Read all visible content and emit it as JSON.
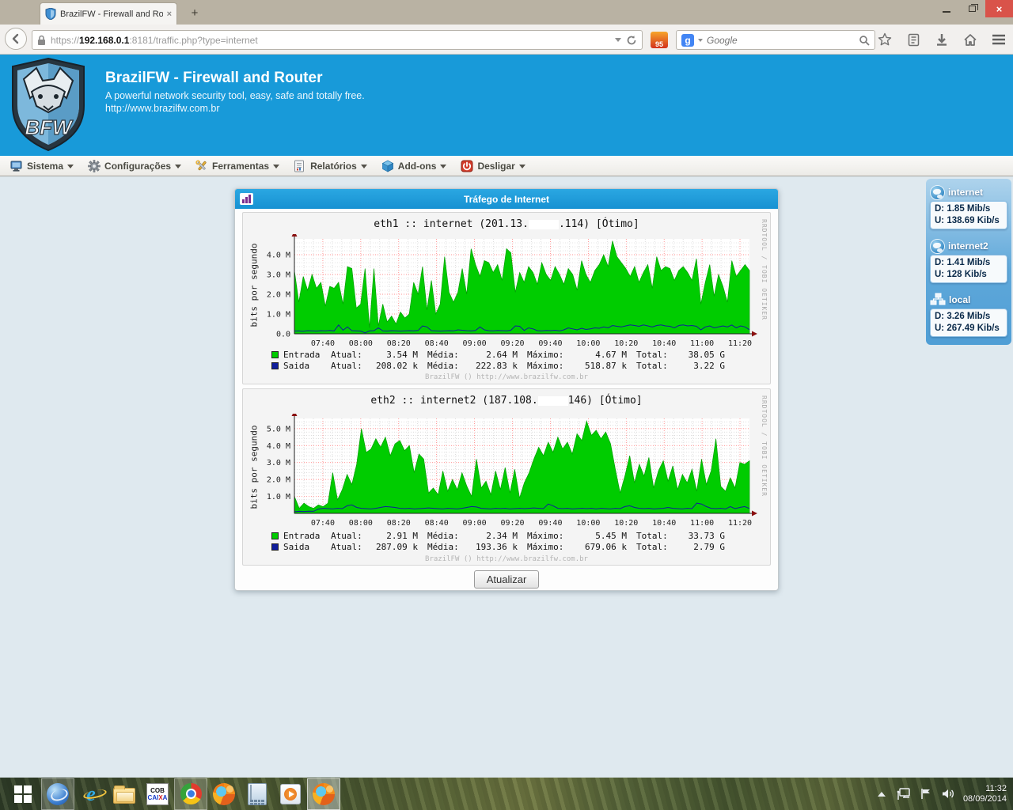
{
  "browser": {
    "tab": {
      "title": "BrazilFW - Firewall and Rou...",
      "close_glyph": "×"
    },
    "new_tab_glyph": "+",
    "url": {
      "protocol": "https://",
      "domain": "192.168.0.1",
      "rest": ":8181/traffic.php?type=internet"
    },
    "extension_badge": "95",
    "search": {
      "engine_initial": "g",
      "placeholder": "Google"
    }
  },
  "site_header": {
    "title": "BrazilFW - Firewall and Router",
    "subtitle": "A powerful network security tool, easy, safe and totally free.",
    "url": "http://www.brazilfw.com.br",
    "logo_text": "BFW"
  },
  "menu": {
    "caret": "▼",
    "items": [
      {
        "label": "Sistema",
        "icon": "computer-icon"
      },
      {
        "label": "Configurações",
        "icon": "gear-icon"
      },
      {
        "label": "Ferramentas",
        "icon": "tools-icon"
      },
      {
        "label": "Relatórios",
        "icon": "report-icon"
      },
      {
        "label": "Add-ons",
        "icon": "addon-cube-icon"
      },
      {
        "label": "Desligar",
        "icon": "power-icon"
      }
    ]
  },
  "panel": {
    "title": "Tráfego de Internet",
    "refresh_button": "Atualizar",
    "legend_labels": {
      "atual": "Atual:",
      "media": "Média:",
      "maximo": "Máximo:",
      "total": "Total:"
    },
    "graphs": [
      {
        "title_prefix": "eth1 :: internet (201.13.",
        "title_suffix": ".114) [Ótimo]",
        "ylabel": "bits por segundo",
        "credit": "RRDTOOL / TOBI OETIKER",
        "watermark": "BrazilFW () http://www.brazilfw.com.br",
        "legend_rows": [
          {
            "name": "Entrada",
            "color": "#00CC00",
            "atual": "3.54 M",
            "media": "2.64 M",
            "maximo": "4.67 M",
            "total": "38.05 G"
          },
          {
            "name": "Saida",
            "color": "#101E9C",
            "atual": "208.02 k",
            "media": "222.83 k",
            "maximo": "518.87 k",
            "total": "3.22 G"
          }
        ]
      },
      {
        "title_prefix": "eth2 :: internet2 (187.108.",
        "title_suffix": "146) [Ótimo]",
        "ylabel": "bits por segundo",
        "credit": "RRDTOOL / TOBI OETIKER",
        "watermark": "BrazilFW () http://www.brazilfw.com.br",
        "legend_rows": [
          {
            "name": "Entrada",
            "color": "#00CC00",
            "atual": "2.91 M",
            "media": "2.34 M",
            "maximo": "5.45 M",
            "total": "33.73 G"
          },
          {
            "name": "Saida",
            "color": "#101E9C",
            "atual": "287.09 k",
            "media": "193.36 k",
            "maximo": "679.06 k",
            "total": "2.79 G"
          }
        ]
      }
    ]
  },
  "chart_data": [
    {
      "type": "area",
      "title": "eth1 :: internet (201.13.***.114) [Ótimo]",
      "xlabel": "",
      "ylabel": "bits por segundo",
      "x_ticks": [
        "07:40",
        "08:00",
        "08:20",
        "08:40",
        "09:00",
        "09:20",
        "09:40",
        "10:00",
        "10:20",
        "10:40",
        "11:00",
        "11:20"
      ],
      "y_ticks": [
        {
          "v": 0,
          "label": "0.0"
        },
        {
          "v": 1,
          "label": "1.0 M"
        },
        {
          "v": 2,
          "label": "2.0 M"
        },
        {
          "v": 3,
          "label": "3.0 M"
        },
        {
          "v": 4,
          "label": "4.0 M"
        }
      ],
      "ylim_m": 4.8,
      "grid": true,
      "legend_position": "bottom",
      "series": [
        {
          "name": "Entrada",
          "style": "area",
          "color": "#00CC00",
          "values_mbps": [
            3.2,
            1.6,
            2.9,
            2.2,
            3.0,
            2.3,
            2.6,
            1.4,
            2.4,
            2.3,
            2.6,
            1.5,
            3.4,
            3.3,
            1.3,
            1.5,
            3.3,
            0.3,
            3.3,
            0.4,
            1.5,
            0.6,
            0.9,
            0.5,
            1.1,
            0.8,
            1.0,
            2.6,
            2.0,
            3.4,
            1.2,
            2.7,
            1.0,
            1.5,
            3.9,
            2.1,
            1.6,
            2.1,
            3.3,
            2.0,
            4.3,
            3.5,
            2.9,
            3.7,
            3.6,
            3.1,
            3.5,
            2.7,
            4.3,
            4.1,
            2.1,
            3.1,
            2.6,
            3.4,
            3.1,
            2.5,
            3.6,
            3.0,
            2.7,
            3.4,
            3.0,
            2.5,
            3.3,
            3.0,
            2.2,
            3.7,
            3.0,
            2.6,
            3.2,
            3.5,
            4.0,
            3.4,
            4.7,
            3.9,
            3.6,
            3.3,
            2.9,
            3.4,
            2.6,
            3.1,
            3.5,
            2.3,
            3.9,
            3.2,
            3.4,
            3.3,
            2.7,
            3.2,
            3.4,
            3.1,
            2.7,
            3.8,
            1.5,
            2.6,
            3.5,
            1.9,
            3.0,
            2.4,
            1.6,
            3.7,
            2.9,
            3.2,
            3.5,
            3.2
          ]
        },
        {
          "name": "Saida",
          "style": "line",
          "color": "#101E9C",
          "values_mbps": [
            0.14,
            0.15,
            0.13,
            0.16,
            0.15,
            0.14,
            0.16,
            0.15,
            0.17,
            0.15,
            0.45,
            0.18,
            0.35,
            0.16,
            0.15,
            0.14,
            0.05,
            0.15,
            0.16,
            0.3,
            0.15,
            0.14,
            0.16,
            0.15,
            0.14,
            0.15,
            0.16,
            0.15,
            0.17,
            0.4,
            0.35,
            0.16,
            0.15,
            0.14,
            0.15,
            0.16,
            0.15,
            0.2,
            0.18,
            0.16,
            0.15,
            0.17,
            0.35,
            0.2,
            0.16,
            0.15,
            0.17,
            0.16,
            0.15,
            0.18,
            0.4,
            0.38,
            0.17,
            0.3,
            0.25,
            0.16,
            0.15,
            0.17,
            0.16,
            0.18,
            0.15,
            0.2,
            0.3,
            0.25,
            0.2,
            0.28,
            0.22,
            0.25,
            0.3,
            0.28,
            0.35,
            0.3,
            0.42,
            0.38,
            0.35,
            0.4,
            0.45,
            0.42,
            0.38,
            0.45,
            0.4,
            0.35,
            0.42,
            0.45,
            0.4,
            0.38,
            0.3,
            0.42,
            0.45,
            0.4,
            0.42,
            0.38,
            0.2,
            0.35,
            0.4,
            0.3,
            0.35,
            0.4,
            0.35,
            0.45,
            0.3,
            0.4,
            0.35,
            0.21
          ]
        }
      ]
    },
    {
      "type": "area",
      "title": "eth2 :: internet2 (187.108.*** 146) [Ótimo]",
      "xlabel": "",
      "ylabel": "bits por segundo",
      "x_ticks": [
        "07:40",
        "08:00",
        "08:20",
        "08:40",
        "09:00",
        "09:20",
        "09:40",
        "10:00",
        "10:20",
        "10:40",
        "11:00",
        "11:20"
      ],
      "y_ticks": [
        {
          "v": 1,
          "label": "1.0 M"
        },
        {
          "v": 2,
          "label": "2.0 M"
        },
        {
          "v": 3,
          "label": "3.0 M"
        },
        {
          "v": 4,
          "label": "4.0 M"
        },
        {
          "v": 5,
          "label": "5.0 M"
        }
      ],
      "ylim_m": 5.6,
      "grid": true,
      "legend_position": "bottom",
      "series": [
        {
          "name": "Entrada",
          "style": "area",
          "color": "#00CC00",
          "values_mbps": [
            1.0,
            0.3,
            0.6,
            0.4,
            0.3,
            0.5,
            0.4,
            0.6,
            2.4,
            0.8,
            1.4,
            2.3,
            1.7,
            2.9,
            5.0,
            3.6,
            3.8,
            4.4,
            3.9,
            4.5,
            3.4,
            4.1,
            4.3,
            3.7,
            4.0,
            2.4,
            3.5,
            3.2,
            1.2,
            1.5,
            1.1,
            2.5,
            1.3,
            2.0,
            1.4,
            2.4,
            1.6,
            1.0,
            3.2,
            1.5,
            1.9,
            1.1,
            2.5,
            1.4,
            2.7,
            1.2,
            2.6,
            0.9,
            1.8,
            2.4,
            3.2,
            3.9,
            3.4,
            4.2,
            3.6,
            4.5,
            3.8,
            4.2,
            3.5,
            4.7,
            4.3,
            5.45,
            4.6,
            4.9,
            4.4,
            4.8,
            4.1,
            2.6,
            1.2,
            2.2,
            3.4,
            1.8,
            2.9,
            2.2,
            3.3,
            1.5,
            2.5,
            3.1,
            1.9,
            2.8,
            1.4,
            2.3,
            1.8,
            2.6,
            1.3,
            3.2,
            1.7,
            2.5,
            4.4,
            1.6,
            1.3,
            2.1,
            1.5,
            3.0,
            2.9,
            3.1
          ]
        },
        {
          "name": "Saida",
          "style": "line",
          "color": "#101E9C",
          "values_mbps": [
            0.1,
            0.12,
            0.11,
            0.13,
            0.12,
            0.25,
            0.3,
            0.28,
            0.26,
            0.3,
            0.28,
            0.45,
            0.5,
            0.35,
            0.3,
            0.28,
            0.26,
            0.3,
            0.35,
            0.4,
            0.38,
            0.35,
            0.3,
            0.28,
            0.3,
            0.26,
            0.28,
            0.3,
            0.32,
            0.3,
            0.28,
            0.26,
            0.3,
            0.28,
            0.26,
            0.3,
            0.35,
            0.4,
            0.38,
            0.3,
            0.28,
            0.26,
            0.3,
            0.28,
            0.3,
            0.26,
            0.28,
            0.3,
            0.28,
            0.3,
            0.32,
            0.3,
            0.28,
            0.55,
            0.45,
            0.3,
            0.28,
            0.3,
            0.26,
            0.28,
            0.3,
            0.28,
            0.3,
            0.26,
            0.3,
            0.28,
            0.26,
            0.3,
            0.28,
            0.4,
            0.45,
            0.35,
            0.3,
            0.28,
            0.3,
            0.26,
            0.28,
            0.3,
            0.35,
            0.3,
            0.28,
            0.26,
            0.3,
            0.28,
            0.6,
            0.55,
            0.4,
            0.3,
            0.28,
            0.3,
            0.26,
            0.4,
            0.28,
            0.35,
            0.4,
            0.29
          ]
        }
      ]
    }
  ],
  "sidebar": {
    "widgets": [
      {
        "name": "internet",
        "icon": "globe-icon",
        "down": "D: 1.85 Mib/s",
        "up": "U: 138.69 Kib/s"
      },
      {
        "name": "internet2",
        "icon": "globe-icon",
        "down": "D: 1.41 Mib/s",
        "up": "U: 128 Kib/s"
      },
      {
        "name": "local",
        "icon": "lan-icon",
        "down": "D: 3.26 Mib/s",
        "up": "U: 267.49 Kib/s"
      }
    ]
  },
  "taskbar": {
    "apps": [
      "start",
      "messenger-sphere",
      "internet-explorer",
      "file-explorer",
      "cob-caixa",
      "chrome",
      "firefox",
      "calculator",
      "media-player",
      "firefox-active"
    ],
    "cob": {
      "line1": "COB",
      "line2_a": "CAI",
      "line2_x": "X",
      "line2_b": "A"
    },
    "clock": {
      "time": "11:32",
      "date": "08/09/2014"
    }
  }
}
